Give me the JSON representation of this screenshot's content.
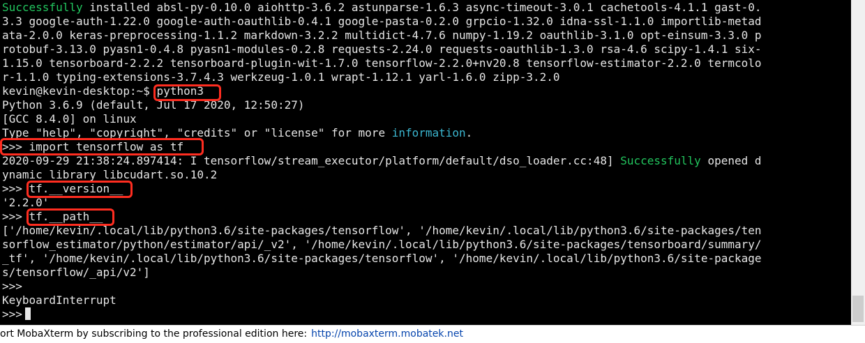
{
  "terminal": {
    "lines": [
      {
        "segments": [
          {
            "text": "Successfully",
            "style": "green"
          },
          {
            "text": " installed absl-py-0.10.0 aiohttp-3.6.2 astunparse-1.6.3 async-timeout-3.0.1 cachetools-4.1.1 gast-0."
          }
        ]
      },
      {
        "segments": [
          {
            "text": "3.3 google-auth-1.22.0 google-auth-oauthlib-0.4.1 google-pasta-0.2.0 grpcio-1.32.0 idna-ssl-1.1.0 importlib-metad"
          }
        ]
      },
      {
        "segments": [
          {
            "text": "ata-2.0.0 keras-preprocessing-1.1.2 markdown-3.2.2 multidict-4.7.6 numpy-1.19.2 oauthlib-3.1.0 opt-einsum-3.3.0 p"
          }
        ]
      },
      {
        "segments": [
          {
            "text": "rotobuf-3.13.0 pyasn1-0.4.8 pyasn1-modules-0.2.8 requests-2.24.0 requests-oauthlib-1.3.0 rsa-4.6 scipy-1.4.1 six-"
          }
        ]
      },
      {
        "segments": [
          {
            "text": "1.15.0 tensorboard-2.2.2 tensorboard-plugin-wit-1.7.0 tensorflow-2.2.0+nv20.8 tensorflow-estimator-2.2.0 termcolo"
          }
        ]
      },
      {
        "segments": [
          {
            "text": "r-1.1.0 typing-extensions-3.7.4.3 werkzeug-1.0.1 wrapt-1.12.1 yarl-1.6.0 zipp-3.2.0"
          }
        ]
      },
      {
        "segments": [
          {
            "text": "kevin@kevin-desktop:~$ python3"
          }
        ]
      },
      {
        "segments": [
          {
            "text": "Python 3.6.9 (default, Jul 17 2020, 12:50:27)"
          }
        ]
      },
      {
        "segments": [
          {
            "text": "[GCC 8.4.0] on linux"
          }
        ]
      },
      {
        "segments": [
          {
            "text": "Type \"help\", \"copyright\", \"credits\" or \"license\" for more "
          },
          {
            "text": "information",
            "style": "cyan"
          },
          {
            "text": "."
          }
        ]
      },
      {
        "segments": [
          {
            "text": ">>> import tensorflow as tf"
          }
        ]
      },
      {
        "segments": [
          {
            "text": "2020-09-29 21:38:24.897414: I tensorflow/stream_executor/platform/default/dso_loader.cc:48] "
          },
          {
            "text": "Successfully",
            "style": "green"
          },
          {
            "text": " opened d"
          }
        ]
      },
      {
        "segments": [
          {
            "text": "ynamic library libcudart.so.10.2"
          }
        ]
      },
      {
        "segments": [
          {
            "text": ">>> tf.__version__"
          }
        ]
      },
      {
        "segments": [
          {
            "text": "'2.2.0'"
          }
        ]
      },
      {
        "segments": [
          {
            "text": ">>> tf.__path__"
          }
        ]
      },
      {
        "segments": [
          {
            "text": "['/home/kevin/.local/lib/python3.6/site-packages/tensorflow', '/home/kevin/.local/lib/python3.6/site-packages/ten"
          }
        ]
      },
      {
        "segments": [
          {
            "text": "sorflow_estimator/python/estimator/api/_v2', '/home/kevin/.local/lib/python3.6/site-packages/tensorboard/summary/"
          }
        ]
      },
      {
        "segments": [
          {
            "text": "_tf', '/home/kevin/.local/lib/python3.6/site-packages/tensorflow', '/home/kevin/.local/lib/python3.6/site-package"
          }
        ]
      },
      {
        "segments": [
          {
            "text": "s/tensorflow/_api/v2']"
          }
        ]
      },
      {
        "segments": [
          {
            "text": ">>>"
          }
        ]
      },
      {
        "segments": [
          {
            "text": "KeyboardInterrupt"
          }
        ]
      },
      {
        "segments": [
          {
            "text": ">>>"
          }
        ],
        "cursor": true
      }
    ]
  },
  "status_bar": {
    "text": "ort MobaXterm by subscribing to the professional edition here:",
    "link": "http://mobaxterm.mobatek.net"
  },
  "colors": {
    "background": "#000000",
    "foreground": "#e6e6e6",
    "success": "#22c55e",
    "link_text": "#3bb7d1",
    "highlight_box": "#ff2d20"
  }
}
